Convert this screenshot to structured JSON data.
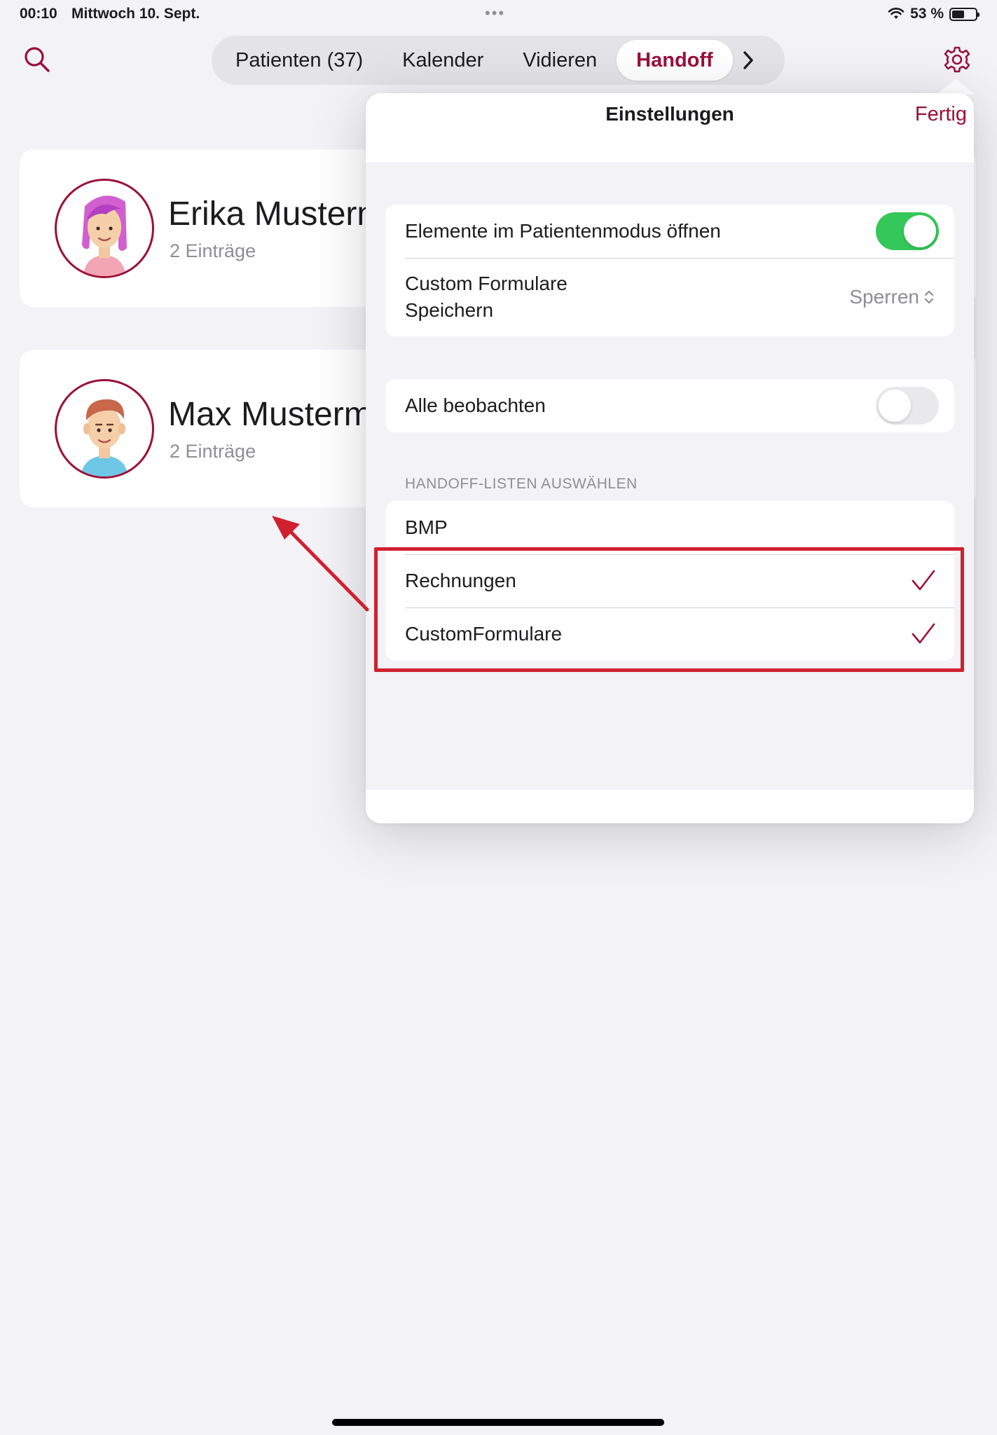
{
  "status_bar": {
    "time": "00:10",
    "date": "Mittwoch 10. Sept.",
    "battery_text": "53 %",
    "battery_level": 0.53
  },
  "nav": {
    "tabs": [
      {
        "label": "Patienten (37)",
        "active": false
      },
      {
        "label": "Kalender",
        "active": false
      },
      {
        "label": "Vidieren",
        "active": false
      },
      {
        "label": "Handoff",
        "active": true
      }
    ],
    "more_icon": "chevron-right-icon",
    "search_icon": "search-icon",
    "settings_icon": "gear-icon"
  },
  "patients": [
    {
      "name": "Erika Mustern",
      "entries": "2 Einträge",
      "avatar": "female-avatar"
    },
    {
      "name": "Max Musterm",
      "entries": "2 Einträge",
      "avatar": "male-avatar"
    }
  ],
  "settings": {
    "title": "Einstellungen",
    "done_label": "Fertig",
    "patient_mode_label": "Elemente im Patientenmodus öffnen",
    "patient_mode_on": true,
    "custom_forms_label_line1": "Custom Formulare",
    "custom_forms_label_line2": "Speichern",
    "custom_forms_value": "Sperren",
    "observe_all_label": "Alle beobachten",
    "observe_all_on": false,
    "handoff_section_header": "HANDOFF-LISTEN AUSWÄHLEN",
    "handoff_lists": [
      {
        "label": "BMP",
        "checked": false
      },
      {
        "label": "Rechnungen",
        "checked": true
      },
      {
        "label": "CustomFormulare",
        "checked": true
      }
    ]
  },
  "colors": {
    "accent": "#9b1038",
    "toggle_on": "#34c759",
    "annotation": "#d0202f",
    "background": "#f2f2f7"
  }
}
